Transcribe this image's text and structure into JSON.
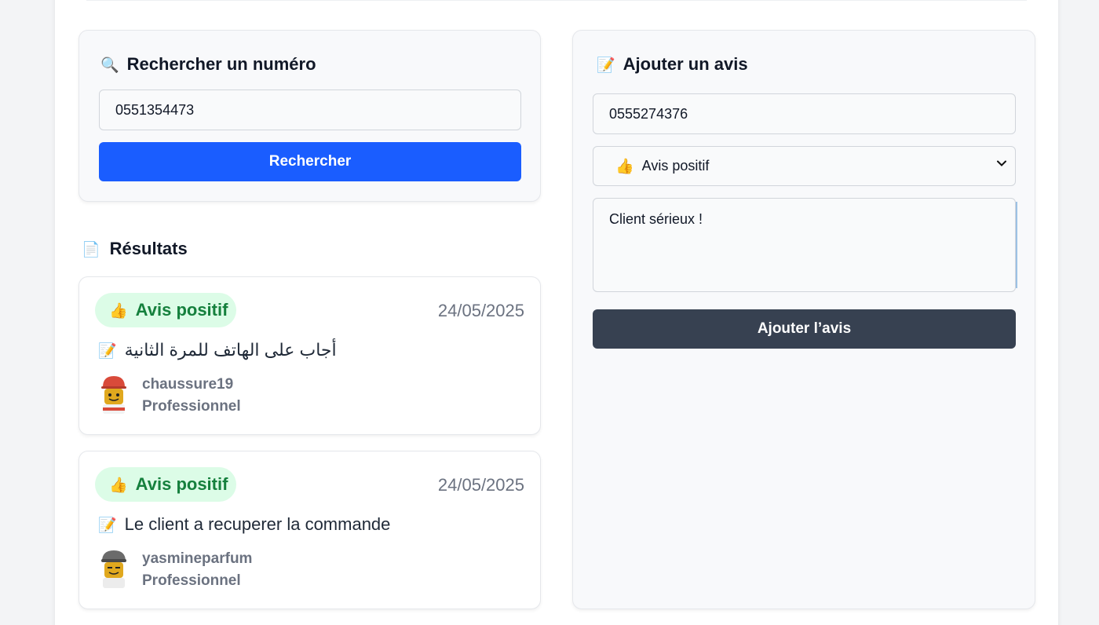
{
  "search": {
    "title": "Rechercher un numéro",
    "icon": "magnifier-icon",
    "input_value": "0551354473",
    "button_label": "Rechercher"
  },
  "results": {
    "title": "Résultats",
    "icon": "document-icon",
    "items": [
      {
        "badge": "Avis positif",
        "badge_icon": "thumbs-up-icon",
        "date": "24/05/2025",
        "comment": "أجاب على الهاتف للمرة الثانية",
        "author": "chaussure19",
        "role": "Professionnel"
      },
      {
        "badge": "Avis positif",
        "badge_icon": "thumbs-up-icon",
        "date": "24/05/2025",
        "comment": "Le client a recuperer la commande",
        "author": "yasmineparfum",
        "role": "Professionnel"
      }
    ]
  },
  "add_review": {
    "title": "Ajouter un avis",
    "icon": "memo-icon",
    "phone_value": "0555274376",
    "select_value": "Avis positif",
    "select_icon": "thumbs-up-icon",
    "comment_value": "Client sérieux !",
    "button_label": "Ajouter l’avis"
  },
  "colors": {
    "primary": "#1a5dff",
    "dark_button": "#374151",
    "badge_bg": "#dcfce7",
    "badge_text": "#15803d"
  }
}
